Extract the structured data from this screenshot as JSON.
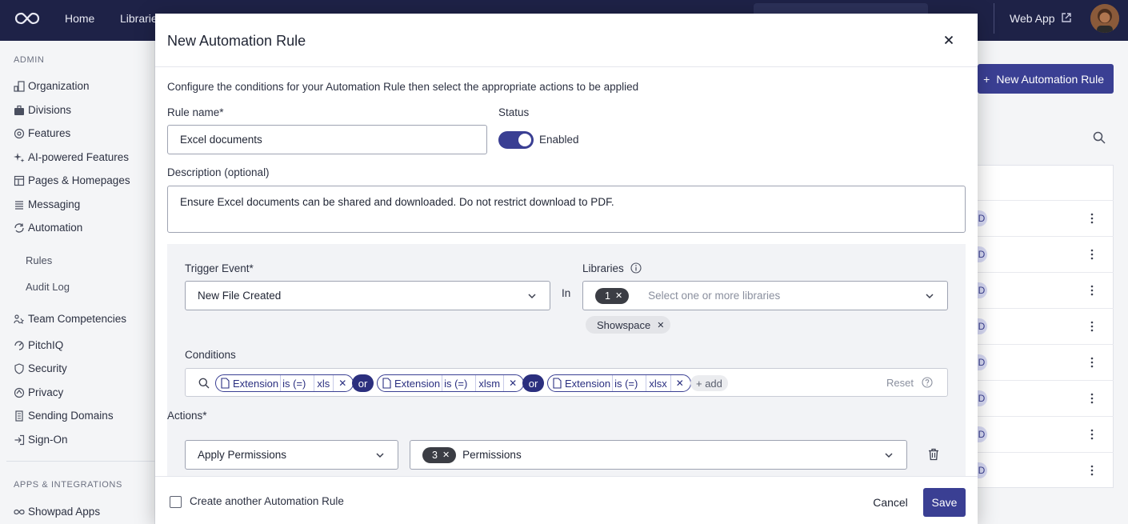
{
  "nav": {
    "links": [
      "Home",
      "Librarie"
    ],
    "web_app": "Web App"
  },
  "sidebar": {
    "admin_section": "ADMIN",
    "items": [
      {
        "label": "Organization",
        "icon": "org-chart-icon"
      },
      {
        "label": "Divisions",
        "icon": "briefcase-icon"
      },
      {
        "label": "Features",
        "icon": "cog-icon"
      },
      {
        "label": "AI-powered Features",
        "icon": "sparkle-icon"
      },
      {
        "label": "Pages & Homepages",
        "icon": "layout-icon"
      },
      {
        "label": "Messaging",
        "icon": "lines-icon"
      },
      {
        "label": "Automation",
        "icon": "automation-icon"
      }
    ],
    "sub_items": [
      "Rules",
      "Audit Log"
    ],
    "items2": [
      {
        "label": "Team Competencies",
        "icon": "team-icon"
      },
      {
        "label": "PitchIQ",
        "icon": "pitch-icon"
      },
      {
        "label": "Security",
        "icon": "shield-icon"
      },
      {
        "label": "Privacy",
        "icon": "privacy-icon"
      },
      {
        "label": "Sending Domains",
        "icon": "domain-icon"
      },
      {
        "label": "Sign-On",
        "icon": "sign-on-icon"
      }
    ],
    "apps_section": "APPS & INTEGRATIONS",
    "apps_items": [
      {
        "label": "Showpad Apps",
        "icon": "infinity-icon"
      }
    ]
  },
  "background": {
    "new_rule_button": "New Automation Rule",
    "badge_letter": "D"
  },
  "modal": {
    "title": "New Automation Rule",
    "intro": "Configure the conditions for your Automation Rule then select the appropriate actions to be applied",
    "rule_name_label": "Rule name*",
    "rule_name_value": "Excel documents",
    "status_label": "Status",
    "status_value": "Enabled",
    "description_label": "Description (optional)",
    "description_value": "Ensure Excel documents can be shared and downloaded. Do not restrict download to PDF.",
    "trigger_label": "Trigger Event*",
    "trigger_value": "New File Created",
    "in_label": "In",
    "libraries_label": "Libraries",
    "libraries_count": "1",
    "libraries_placeholder": "Select one or more libraries",
    "library_chip": "Showspace",
    "conditions_label": "Conditions",
    "conditions": [
      {
        "field": "Extension",
        "op": "is (=)",
        "value": "xls"
      },
      {
        "field": "Extension",
        "op": "is (=)",
        "value": "xlsm"
      },
      {
        "field": "Extension",
        "op": "is (=)",
        "value": "xlsx"
      }
    ],
    "or_label": "or",
    "add_label": "+ add",
    "reset_label": "Reset",
    "actions_label": "Actions*",
    "action_value": "Apply Permissions",
    "permissions_count": "3",
    "permissions_label": "Permissions",
    "create_another_label": "Create another Automation Rule",
    "cancel_label": "Cancel",
    "save_label": "Save"
  },
  "colors": {
    "primary": "#3a3f93",
    "nav_bg": "#1e2247"
  }
}
